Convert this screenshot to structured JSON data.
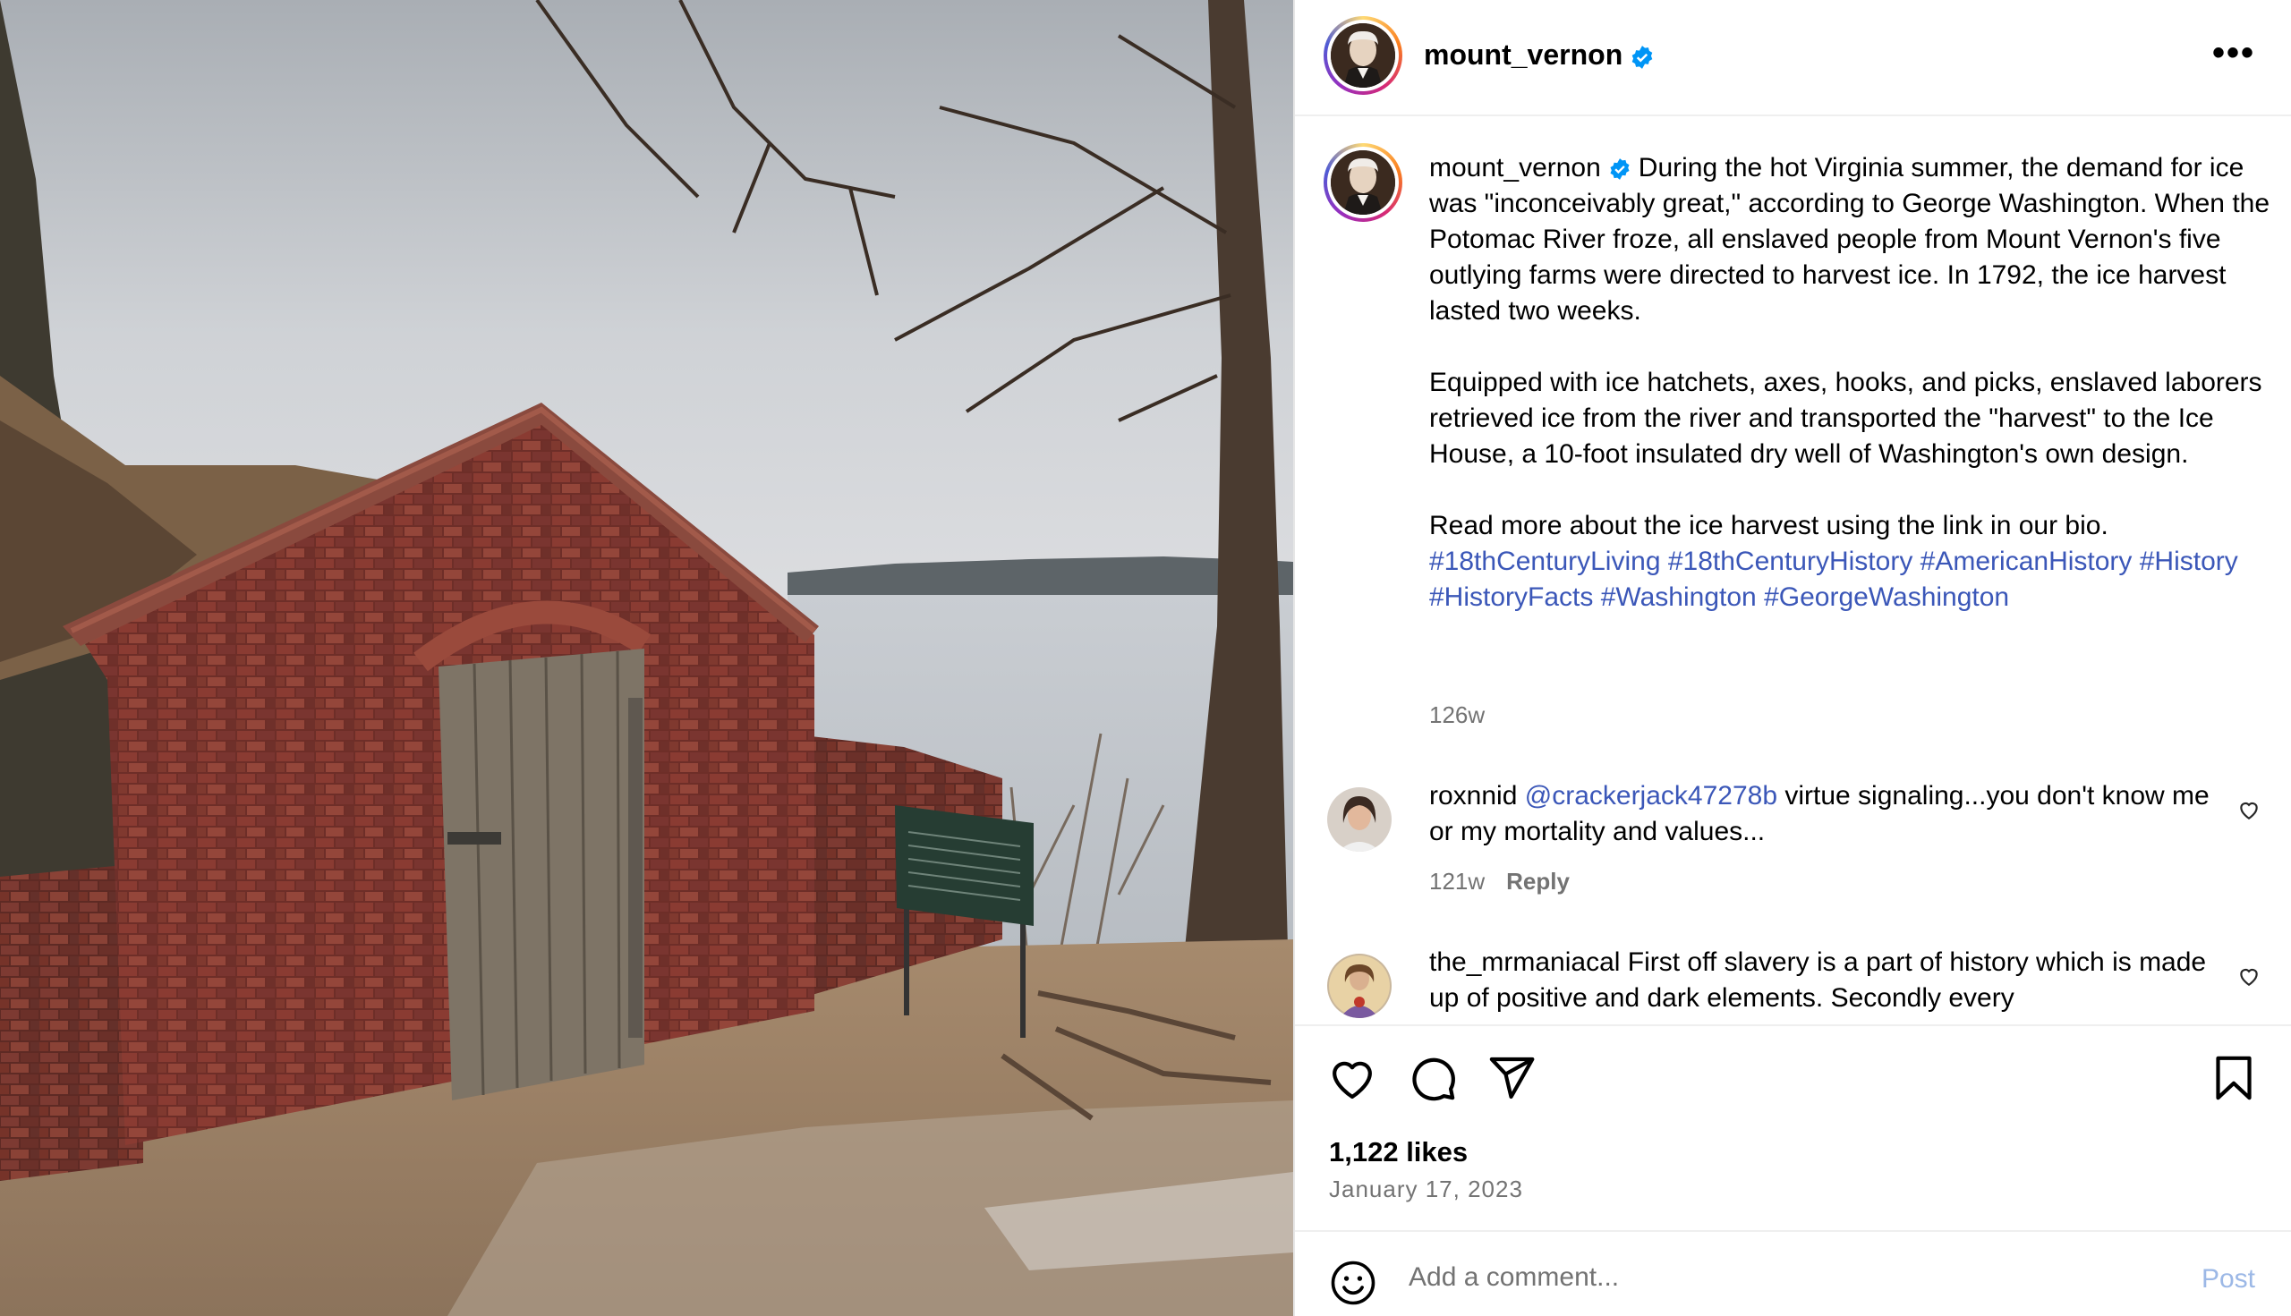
{
  "post": {
    "username": "mount_vernon",
    "more_label": "•••",
    "caption": {
      "username": "mount_vernon",
      "para1": "During the hot Virginia summer, the demand for ice was \"inconceivably great,\" according to George Washington. When the Potomac River froze, all enslaved people from Mount Vernon's five outlying farms were directed to harvest ice. In 1792, the ice harvest lasted two weeks.",
      "para2": "Equipped with ice hatchets, axes, hooks, and picks, enslaved laborers retrieved ice from the river and transported the \"harvest\" to the Ice House, a 10-foot insulated dry well of Washington's own design.",
      "para3": "Read more about the ice harvest using the link in our bio.",
      "hashtags": [
        "#18thCenturyLiving",
        "#18thCenturyHistory",
        "#AmericanHistory",
        "#History",
        "#HistoryFacts",
        "#Washington",
        "#GeorgeWashington"
      ]
    },
    "time_ago": "126w"
  },
  "comments": [
    {
      "username": "roxnnid",
      "mention": "@crackerjack47278b",
      "text": "virtue signaling...you don't know me or my mortality and values...",
      "time_ago": "121w",
      "reply_label": "Reply"
    },
    {
      "username": "the_mrmaniacal",
      "text": "First off slavery is a part of history which is made up of positive and dark elements. Secondly every"
    }
  ],
  "actions": {
    "likes": "1,122 likes",
    "date": "January 17, 2023"
  },
  "comment_box": {
    "placeholder": "Add a comment...",
    "post_label": "Post"
  },
  "colors": {
    "link": "#3b57b8",
    "verified": "#0095f6",
    "muted": "#737373",
    "post_disabled": "#9cb8e6"
  },
  "icons": [
    "verified-badge-icon",
    "more-options-icon",
    "heart-icon",
    "comment-icon",
    "share-icon",
    "bookmark-icon",
    "emoji-icon"
  ]
}
